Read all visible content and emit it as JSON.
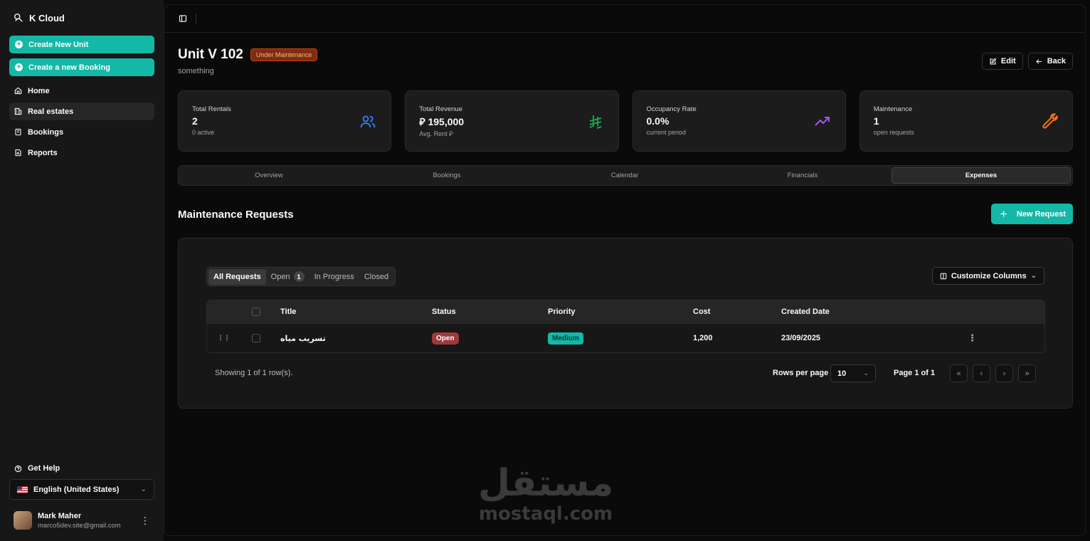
{
  "app": {
    "brand": "K Cloud"
  },
  "sidebar": {
    "actions": [
      {
        "label": "Create New Unit"
      },
      {
        "label": "Create a new Booking"
      }
    ],
    "items": [
      {
        "label": "Home",
        "icon": "home-icon"
      },
      {
        "label": "Real estates",
        "icon": "building-icon"
      },
      {
        "label": "Bookings",
        "icon": "book-icon"
      },
      {
        "label": "Reports",
        "icon": "report-icon"
      }
    ],
    "help": "Get Help",
    "language": "English (United States)",
    "user": {
      "name": "Mark Maher",
      "email": "marco5dev.site@gmail.com"
    }
  },
  "page": {
    "title": "Unit V 102",
    "status_badge": "Under Maintenance",
    "subtitle": "something",
    "edit_label": "Edit",
    "back_label": "Back"
  },
  "stats": [
    {
      "label": "Total Rentals",
      "value": "2",
      "sub": "0 active",
      "icon": "users-icon",
      "color": "#3b82f6"
    },
    {
      "label": "Total Revenue",
      "value": "⃁ 195,000",
      "sub": "Avg. Rent ⃁",
      "icon": "riyal-icon",
      "color": "#16a34a"
    },
    {
      "label": "Occupancy Rate",
      "value": "0.0%",
      "sub": "current period",
      "icon": "trending-up-icon",
      "color": "#a855f7"
    },
    {
      "label": "Maintenance",
      "value": "1",
      "sub": "open requests",
      "icon": "wrench-icon",
      "color": "#f97316"
    }
  ],
  "tabs": [
    "Overview",
    "Bookings",
    "Calendar",
    "Financials",
    "Expenses"
  ],
  "active_tab": "Expenses",
  "section": {
    "title": "Maintenance Requests",
    "new_request": "New Request"
  },
  "filters": {
    "all": "All Requests",
    "open": "Open",
    "open_count": "1",
    "in_progress": "In Progress",
    "closed": "Closed",
    "customize": "Customize Columns"
  },
  "table": {
    "columns": [
      "Title",
      "Status",
      "Priority",
      "Cost",
      "Created Date"
    ],
    "rows": [
      {
        "title": "تسريب مياه",
        "status": "Open",
        "priority": "Medium",
        "cost": "1,200",
        "created": "23/09/2025"
      }
    ]
  },
  "pagination": {
    "showing": "Showing 1 of 1 row(s).",
    "rows_per_page_label": "Rows per page",
    "rows_per_page": "10",
    "page_info": "Page 1 of 1"
  },
  "watermark": {
    "arabic": "مستقل",
    "latin": "mostaql.com"
  },
  "colors": {
    "accent": "#14b8a6",
    "danger": "#9f3a3a",
    "warning": "#c2410c"
  }
}
